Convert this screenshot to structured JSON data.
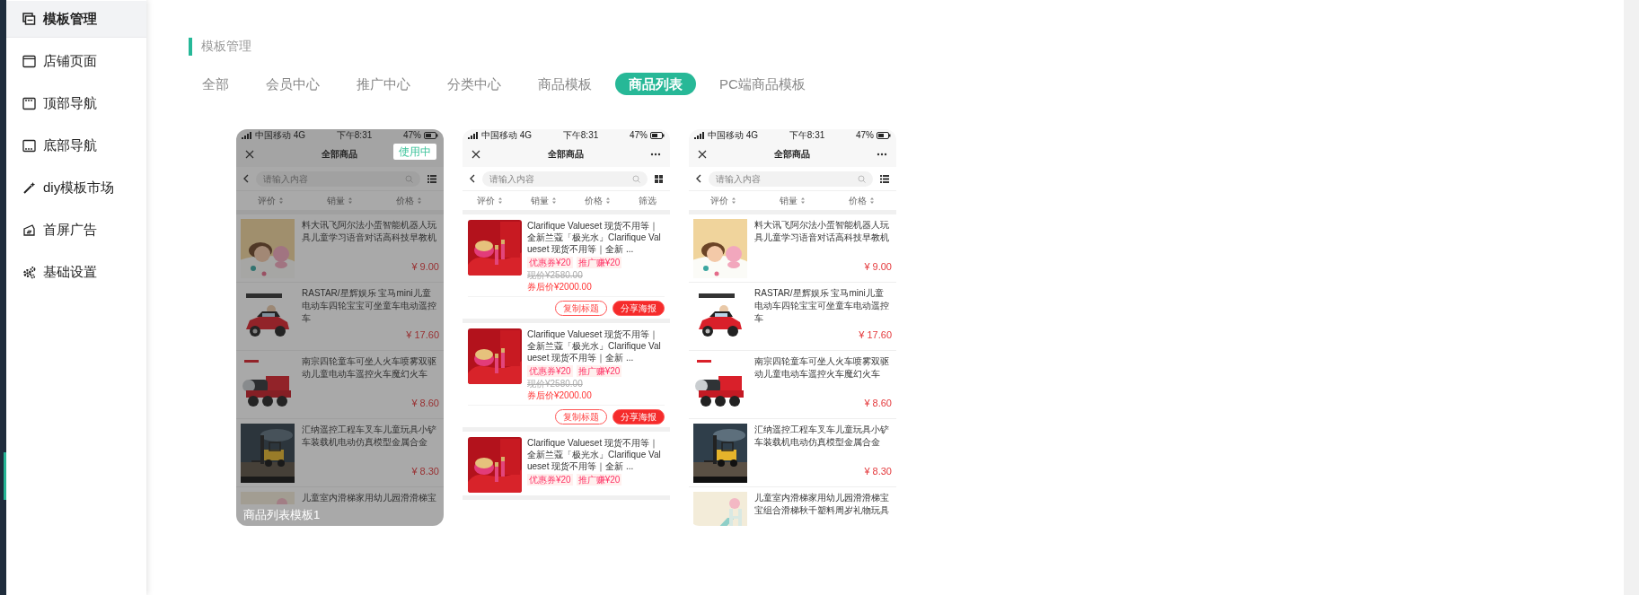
{
  "sidebar": {
    "items": [
      {
        "label": "模板管理",
        "selected": true
      },
      {
        "label": "店铺页面",
        "selected": false
      },
      {
        "label": "顶部导航",
        "selected": false
      },
      {
        "label": "底部导航",
        "selected": false
      },
      {
        "label": "diy模板市场",
        "selected": false
      },
      {
        "label": "首屏广告",
        "selected": false
      },
      {
        "label": "基础设置",
        "selected": false
      }
    ]
  },
  "page_title": "模板管理",
  "tabs": [
    {
      "label": "全部",
      "selected": false
    },
    {
      "label": "会员中心",
      "selected": false
    },
    {
      "label": "推广中心",
      "selected": false
    },
    {
      "label": "分类中心",
      "selected": false
    },
    {
      "label": "商品模板",
      "selected": false
    },
    {
      "label": "商品列表",
      "selected": true
    },
    {
      "label": "PC端商品模板",
      "selected": false
    }
  ],
  "templates": [
    {
      "kind": "list",
      "in_use": true,
      "badge": "使用中",
      "caption": "商品列表模板1",
      "phone": {
        "carrier": "中国移动 4G",
        "time": "下午8:31",
        "battery": "47%",
        "title": "全部商品",
        "search_placeholder": "请输入内容",
        "sort_options": [
          {
            "label": "评价",
            "sortable": true
          },
          {
            "label": "销量",
            "sortable": true
          },
          {
            "label": "价格",
            "sortable": true
          }
        ],
        "products": [
          {
            "title": "料大讯飞阿尔法小蛋智能机器人玩具儿童学习语音对话高科技早教机",
            "price": "¥ 9.00"
          },
          {
            "title": "RASTAR/星辉娱乐 宝马mini儿童电动车四轮宝宝可坐童车电动遥控车",
            "price": "¥ 17.60"
          },
          {
            "title": "南宗四轮童车可坐人火车喷雾双驱动儿童电动车遥控火车魔幻火车",
            "price": "¥ 8.60"
          },
          {
            "title": "汇纳遥控工程车叉车儿童玩具小铲车装载机电动仿真模型金属合金",
            "price": "¥ 8.30"
          },
          {
            "title": "儿童室内滑梯家用幼儿园滑滑梯宝"
          }
        ]
      }
    },
    {
      "kind": "promo",
      "in_use": false,
      "phone": {
        "carrier": "中国移动 4G",
        "time": "下午8:31",
        "battery": "47%",
        "title": "全部商品",
        "search_placeholder": "请输入内容",
        "sort_options": [
          {
            "label": "评价",
            "sortable": true
          },
          {
            "label": "销量",
            "sortable": true
          },
          {
            "label": "价格",
            "sortable": true
          },
          {
            "label": "筛选",
            "sortable": false
          }
        ],
        "products": [
          {
            "title": "Clarifique Valueset 现货不用等｜全新兰蔻「极光水」Clarifique Valueset 现货不用等｜全新 ...",
            "tags": [
              "优惠券¥20",
              "推广赚¥20"
            ],
            "original_price": "现价¥2580.00",
            "coupon_price": "券后价¥2000.00",
            "actions": [
              {
                "label": "复制标题",
                "kind": "outline"
              },
              {
                "label": "分享海报",
                "kind": "filled"
              }
            ]
          },
          {
            "title": "Clarifique Valueset 现货不用等｜全新兰蔻「极光水」Clarifique Valueset 现货不用等｜全新 ...",
            "tags": [
              "优惠券¥20",
              "推广赚¥20"
            ],
            "original_price": "现价¥2580.00",
            "coupon_price": "券后价¥2000.00",
            "actions": [
              {
                "label": "复制标题",
                "kind": "outline"
              },
              {
                "label": "分享海报",
                "kind": "filled"
              }
            ]
          },
          {
            "title": "Clarifique Valueset 现货不用等｜全新兰蔻「极光水」Clarifique Valueset 现货不用等｜全新 ...",
            "tags": [
              "优惠券¥20",
              "推广赚¥20"
            ]
          }
        ]
      }
    },
    {
      "kind": "list",
      "in_use": false,
      "phone": {
        "carrier": "中国移动 4G",
        "time": "下午8:31",
        "battery": "47%",
        "title": "全部商品",
        "search_placeholder": "请输入内容",
        "sort_options": [
          {
            "label": "评价",
            "sortable": true
          },
          {
            "label": "销量",
            "sortable": true
          },
          {
            "label": "价格",
            "sortable": true
          }
        ],
        "products": [
          {
            "title": "料大讯飞阿尔法小蛋智能机器人玩具儿童学习语音对话高科技早教机",
            "price": "¥ 9.00"
          },
          {
            "title": "RASTAR/星辉娱乐 宝马mini儿童电动车四轮宝宝可坐童车电动遥控车",
            "price": "¥ 17.60"
          },
          {
            "title": "南宗四轮童车可坐人火车喷雾双驱动儿童电动车遥控火车魔幻火车",
            "price": "¥ 8.60"
          },
          {
            "title": "汇纳遥控工程车叉车儿童玩具小铲车装载机电动仿真模型金属合金",
            "price": "¥ 8.30"
          },
          {
            "title": "儿童室内滑梯家用幼儿园滑滑梯宝宝组合滑梯秋千塑料周岁礼物玩具"
          }
        ]
      }
    }
  ]
}
